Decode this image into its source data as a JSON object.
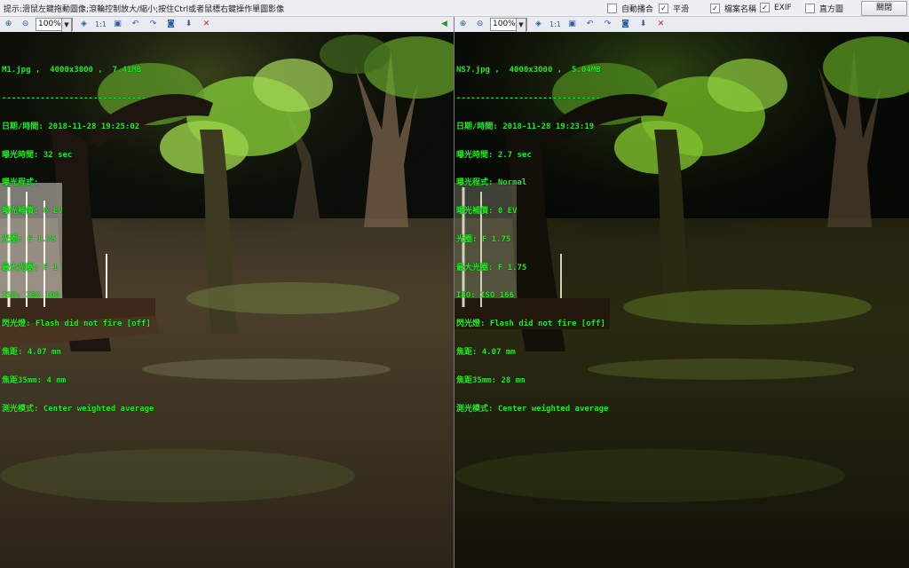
{
  "window": {
    "tip": "提示:滑鼠左鍵拖動圖像;滾輪控制放大/縮小;按住Ctrl或者鼠標右鍵操作單圖影像",
    "options": [
      {
        "label": "自動播合",
        "checked": false
      },
      {
        "label": "平滑",
        "checked": true
      },
      {
        "label": "檔案名稱",
        "checked": true
      },
      {
        "label": "EXIF",
        "checked": true
      },
      {
        "label": "直方圖",
        "checked": false
      }
    ],
    "close_label": "關閉"
  },
  "toolbar": {
    "zoom_value": "100%",
    "one_to_one": "1:1",
    "icons": [
      "zoom-in-icon",
      "zoom-out-icon",
      "fit-icon",
      "one-to-one-icon",
      "fit-window-icon",
      "rotate-left-icon",
      "rotate-right-icon",
      "save-icon",
      "export-icon",
      "delete-icon",
      "sync-arrow-icon"
    ],
    "delete_color": "#d0201c"
  },
  "left": {
    "lines": [
      "M1.jpg ,  4000x3000 ,  7.41MB",
      "------------------------------",
      "日期/時間: 2018-11-28 19:25:02",
      "曝光時間: 32 sec",
      "曝光程式:",
      "曝光補償: 0 EV",
      "光圈: F 1.75",
      "最大光圈: F 1",
      "ISO: ISO 100",
      "閃光燈: Flash did not fire [off]",
      "焦距: 4.07 mm",
      "焦距35mm: 4 mm",
      "測光模式: Center weighted average"
    ]
  },
  "right": {
    "lines": [
      "NS7.jpg ,  4000x3000 ,  5.04MB",
      "------------------------------",
      "日期/時間: 2018-11-28 19:23:19",
      "曝光時間: 2.7 sec",
      "曝光程式: Normal",
      "曝光補償: 0 EV",
      "光圈: F 1.75",
      "最大光圈: F 1.75",
      "ISO: ISO 166",
      "閃光燈: Flash did not fire [off]",
      "焦距: 4.07 mm",
      "焦距35mm: 28 mm",
      "測光模式: Center weighted average"
    ]
  },
  "colors": {
    "exif_text": "#22ee22",
    "lit_leaves": "#8fcf3a"
  }
}
